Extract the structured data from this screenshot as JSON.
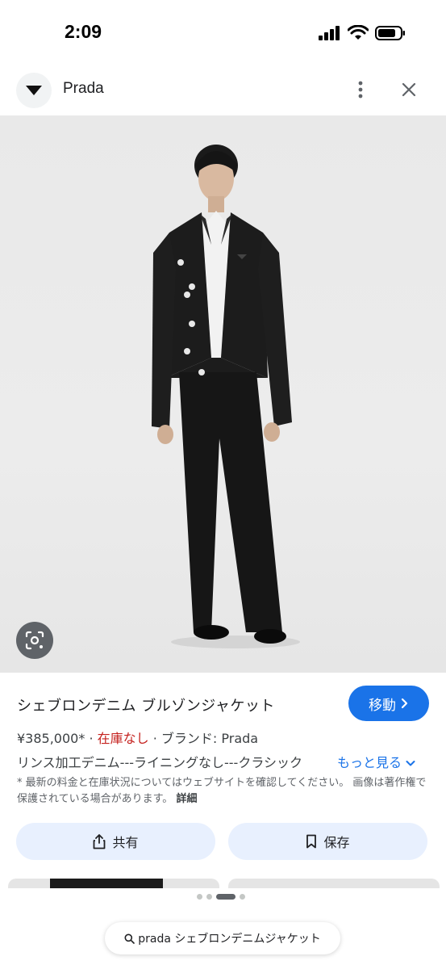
{
  "status_bar": {
    "time": "2:09"
  },
  "site": {
    "name": "Prada"
  },
  "product": {
    "title": "シェブロンデニム ブルゾンジャケット",
    "price": "¥385,000*",
    "sep1": "·",
    "stock": "在庫なし",
    "sep2": "·",
    "brand": "ブランド: Prada",
    "description": "リンス加工デニム---ライニングなし---クラシック",
    "more_link": "もっと見る",
    "disclaimer": "* 最新の料金と在庫状況についてはウェブサイトを確認してください。 画像は著作権で保護されている場合があります。",
    "details_link": "詳細"
  },
  "actions": {
    "visit": "移動",
    "share": "共有",
    "save": "保存"
  },
  "search": {
    "query": "prada シェブロンデニムジャケット"
  },
  "colors": {
    "accent": "#1a73e8",
    "stock_out": "#c5221f",
    "chip_bg": "#e8f0fe"
  }
}
